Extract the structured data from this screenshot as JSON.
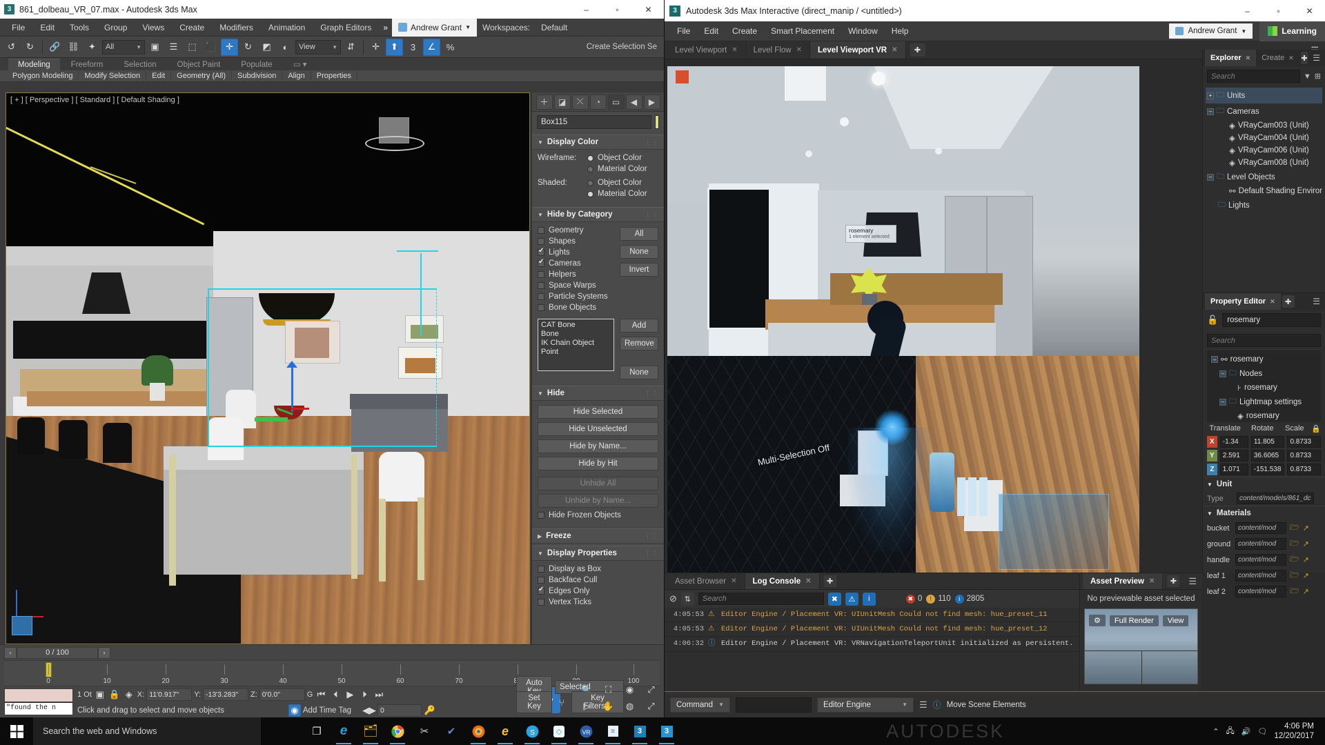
{
  "max_window": {
    "title": "861_dolbeau_VR_07.max - Autodesk 3ds Max",
    "app_icon": "3",
    "window_controls": {
      "minimize": "–",
      "maximize": "▫",
      "close": "✕"
    },
    "menus": [
      "File",
      "Edit",
      "Tools",
      "Group",
      "Views",
      "Create",
      "Modifiers",
      "Animation",
      "Graph Editors"
    ],
    "overflow": "»",
    "user": "Andrew Grant",
    "workspaces_label": "Workspaces:",
    "workspace_value": "Default",
    "toolbar": {
      "selection_filter": "All",
      "ref_coord_system": "View",
      "create_selection_set_label": "Create Selection Se"
    },
    "ribbon_tabs": [
      "Modeling",
      "Freeform",
      "Selection",
      "Object Paint",
      "Populate"
    ],
    "ribbon_sub": [
      "Polygon Modeling",
      "Modify Selection",
      "Edit",
      "Geometry (All)",
      "Subdivision",
      "Align",
      "Properties"
    ],
    "viewport_label": "[ + ] [ Perspective ] [ Standard ] [ Default Shading ]",
    "command_panel": {
      "object_name": "Box115",
      "object_color": "#d8dd8e",
      "rollouts": [
        {
          "title": "Display Color",
          "rows": [
            {
              "label": "Wireframe:",
              "options": [
                {
                  "text": "Object Color",
                  "selected": true
                },
                {
                  "text": "Material Color",
                  "selected": false
                }
              ]
            },
            {
              "label": "Shaded:",
              "options": [
                {
                  "text": "Object Color",
                  "selected": false
                },
                {
                  "text": "Material Color",
                  "selected": true
                }
              ]
            }
          ]
        },
        {
          "title": "Hide by Category",
          "categories": [
            {
              "label": "Geometry",
              "checked": false
            },
            {
              "label": "Shapes",
              "checked": false
            },
            {
              "label": "Lights",
              "checked": true
            },
            {
              "label": "Cameras",
              "checked": true
            },
            {
              "label": "Helpers",
              "checked": false
            },
            {
              "label": "Space Warps",
              "checked": false
            },
            {
              "label": "Particle Systems",
              "checked": false
            },
            {
              "label": "Bone Objects",
              "checked": false
            }
          ],
          "buttons": [
            "All",
            "None",
            "Invert"
          ],
          "list_items": [
            "CAT Bone",
            "Bone",
            "IK Chain Object",
            "Point"
          ],
          "list_buttons": [
            "Add",
            "Remove",
            "None"
          ]
        },
        {
          "title": "Hide",
          "buttons": [
            {
              "label": "Hide Selected",
              "enabled": true
            },
            {
              "label": "Hide Unselected",
              "enabled": true
            },
            {
              "label": "Hide by Name...",
              "enabled": true
            },
            {
              "label": "Hide by Hit",
              "enabled": true
            },
            {
              "label": "Unhide All",
              "enabled": false
            },
            {
              "label": "Unhide by Name...",
              "enabled": false
            }
          ],
          "checkbox": {
            "label": "Hide Frozen Objects",
            "checked": false
          }
        },
        {
          "title": "Freeze",
          "collapsed": true
        },
        {
          "title": "Display Properties",
          "checks": [
            {
              "label": "Display as Box",
              "checked": false
            },
            {
              "label": "Backface Cull",
              "checked": false
            },
            {
              "label": "Edges Only",
              "checked": true
            },
            {
              "label": "Vertex Ticks",
              "checked": false
            }
          ]
        }
      ]
    },
    "status_bar": {
      "frame_field": "0 / 100",
      "timeline_ticks": [
        "0",
        "10",
        "20",
        "30",
        "40",
        "50",
        "60",
        "70",
        "80",
        "90",
        "100"
      ],
      "listener_text": "\"found the n",
      "object_count": "1 Ot",
      "coord_x_label": "X:",
      "coord_x": "11'0.917\"",
      "coord_y_label": "Y:",
      "coord_y": "-13'3.283\"",
      "coord_z_label": "Z:",
      "coord_z": "0'0.0\"",
      "grid_label": "G",
      "prompt": "Click and drag to select and move objects",
      "add_time_tag": "Add Time Tag",
      "key_frame_value": "0",
      "auto_key": "Auto Key",
      "set_key": "Set Key",
      "key_mode": "Selected",
      "key_filters": "Key Filters..."
    }
  },
  "interactive_window": {
    "title": "Autodesk 3ds Max Interactive (direct_manip / <untitled>)",
    "app_icon": "3",
    "window_controls": {
      "minimize": "–",
      "maximize": "▫",
      "close": "✕"
    },
    "menus": [
      "File",
      "Edit",
      "Create",
      "Smart Placement",
      "Window",
      "Help"
    ],
    "user": "Andrew Grant",
    "learning_label": "Learning",
    "viewport_tabs": [
      {
        "label": "Level Viewport",
        "active": false
      },
      {
        "label": "Level Flow",
        "active": false
      },
      {
        "label": "Level Viewport VR",
        "active": true
      }
    ],
    "viewport_overlays": {
      "object_tag": "rosemary",
      "object_tag_sub": "1 element selected",
      "mode_text": "Multi-Selection Off"
    },
    "explorer": {
      "tabs": [
        {
          "label": "Explorer",
          "active": true
        },
        {
          "label": "Create",
          "active": false
        }
      ],
      "search_placeholder": "Search",
      "tree": [
        {
          "label": "Units",
          "depth": 0,
          "type": "folder",
          "expander": "+",
          "selected": true
        },
        {
          "label": "Cameras",
          "depth": 0,
          "type": "folder",
          "expander": "–"
        },
        {
          "label": "VRayCam003 (Unit)",
          "depth": 1,
          "type": "unit"
        },
        {
          "label": "VRayCam004 (Unit)",
          "depth": 1,
          "type": "unit"
        },
        {
          "label": "VRayCam006 (Unit)",
          "depth": 1,
          "type": "unit"
        },
        {
          "label": "VRayCam008 (Unit)",
          "depth": 1,
          "type": "unit"
        },
        {
          "label": "Level Objects",
          "depth": 0,
          "type": "folder",
          "expander": "–"
        },
        {
          "label": "Default Shading Environm",
          "depth": 1,
          "type": "node"
        },
        {
          "label": "Lights",
          "depth": 0,
          "type": "folder"
        }
      ]
    },
    "property_editor": {
      "tab_label": "Property Editor",
      "locked_name": "rosemary",
      "search_placeholder": "Search",
      "tree": [
        {
          "label": "rosemary",
          "depth": 0,
          "type": "node",
          "expander": "–"
        },
        {
          "label": "Nodes",
          "depth": 1,
          "type": "folder",
          "expander": "–"
        },
        {
          "label": "rosemary",
          "depth": 2,
          "type": "bone"
        },
        {
          "label": "Lightmap settings",
          "depth": 1,
          "type": "folder",
          "expander": "–"
        },
        {
          "label": "rosemary",
          "depth": 2,
          "type": "unit"
        }
      ],
      "transform_headers": [
        "Translate",
        "Rotate",
        "Scale"
      ],
      "transform_rows": [
        {
          "axis": "X",
          "color": "#c0432c",
          "translate": "-1.34",
          "rotate": "11.805",
          "scale": "0.8733"
        },
        {
          "axis": "Y",
          "color": "#6d8a48",
          "translate": "2.591",
          "rotate": "36.6065",
          "scale": "0.8733"
        },
        {
          "axis": "Z",
          "color": "#3d7fae",
          "translate": "1.071",
          "rotate": "-151.538",
          "scale": "0.8733"
        }
      ],
      "unit_section": "Unit",
      "unit_type_label": "Type",
      "unit_type_value": "content/models/861_dc",
      "materials_section": "Materials",
      "materials": [
        {
          "name": "bucket",
          "value": "content/mod"
        },
        {
          "name": "ground",
          "value": "content/mod"
        },
        {
          "name": "handle",
          "value": "content/mod"
        },
        {
          "name": "leaf 1",
          "value": "content/mod"
        },
        {
          "name": "leaf 2",
          "value": "content/mod"
        }
      ]
    },
    "log_console": {
      "tabs": [
        {
          "label": "Asset Browser",
          "active": false
        },
        {
          "label": "Log Console",
          "active": true
        }
      ],
      "search_placeholder": "Search",
      "counts": {
        "errors": "0",
        "warnings": "110",
        "infos": "2805"
      },
      "entries": [
        {
          "time": "4:05:53",
          "level": "warning",
          "text": "Editor Engine / Placement VR: UIUnitMesh Could not find mesh: hue_preset_11"
        },
        {
          "time": "4:05:53",
          "level": "warning",
          "text": "Editor Engine / Placement VR: UIUnitMesh Could not find mesh: hue_preset_12"
        },
        {
          "time": "4:06:32",
          "level": "info",
          "text": "Editor Engine / Placement VR: VRNavigationTeleportUnit initialized as persistent."
        }
      ]
    },
    "asset_preview": {
      "tab_label": "Asset Preview",
      "empty_text": "No previewable asset selected",
      "buttons": [
        "Full Render",
        "View"
      ]
    },
    "command_bar": {
      "command_label": "Command",
      "input_value": "",
      "engine_label": "Editor Engine",
      "status_text": "Move Scene Elements"
    }
  },
  "taskbar": {
    "start_icon": "windows-logo",
    "search_placeholder": "Search the web and Windows",
    "icons": [
      "task-view-icon",
      "edge-icon",
      "file-explorer-icon",
      "chrome-icon",
      "snip-icon",
      "checkmark-icon",
      "firefox-icon",
      "ie-icon",
      "skype-icon",
      "drop-icon",
      "vr-icon",
      "notes-icon",
      "max-icon-1",
      "max-icon-2"
    ],
    "watermark": "AUTODESK",
    "tray": [
      "chevron-up-icon",
      "network-icon",
      "volume-icon",
      "notifications-icon"
    ],
    "time": "4:06 PM",
    "date": "12/20/2017"
  }
}
